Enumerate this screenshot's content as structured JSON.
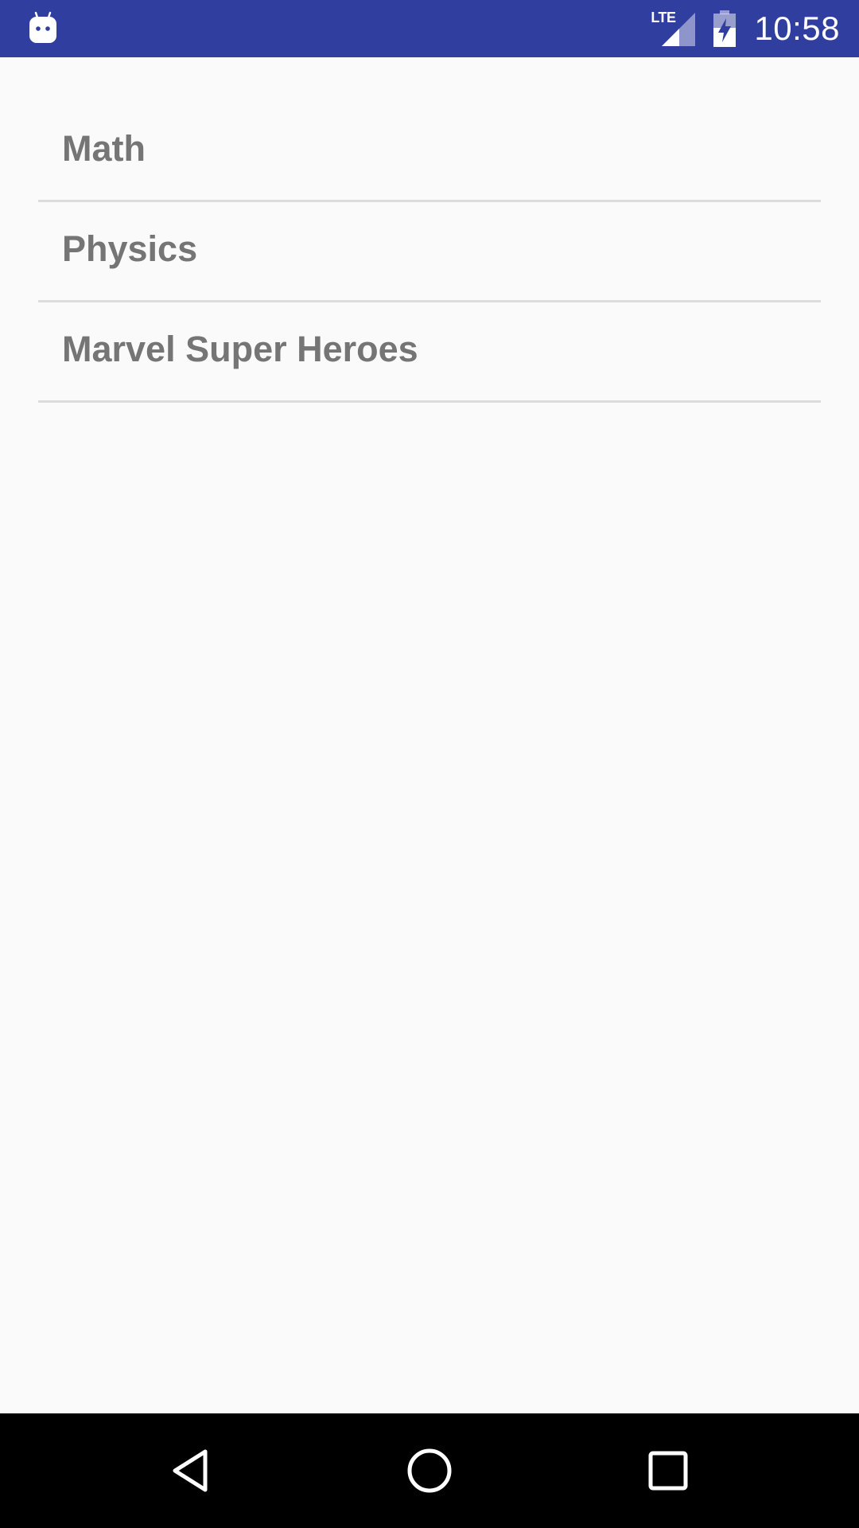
{
  "status_bar": {
    "time": "10:58",
    "network": "LTE",
    "background_color": "#303f9f"
  },
  "list": {
    "items": [
      {
        "label": "Math"
      },
      {
        "label": "Physics"
      },
      {
        "label": "Marvel Super Heroes"
      }
    ],
    "text_color": "#757575",
    "divider_color": "#dcdcdc"
  },
  "nav_bar": {
    "buttons": [
      {
        "icon": "back-triangle-icon"
      },
      {
        "icon": "home-circle-icon"
      },
      {
        "icon": "recents-square-icon"
      }
    ]
  }
}
